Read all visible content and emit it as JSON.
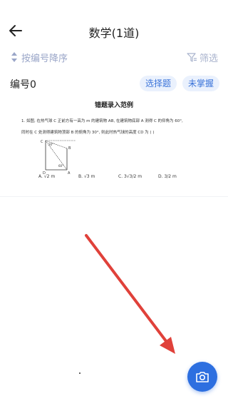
{
  "header": {
    "title": "数学(1道)"
  },
  "toolbar": {
    "sort_label": "按编号降序",
    "filter_label": "筛选"
  },
  "item": {
    "number_label": "编号0",
    "type_tag": "选择题",
    "status_tag": "未掌握"
  },
  "question": {
    "title": "错题录入范例",
    "line1": "1. 如图, 在热气球 C 正前方有一高为 m 的建筑物 AB, 在建筑物底部 A 测得 C 的仰角为 60°,",
    "line2": "同时在 C 处测得建筑物顶部 B 的俯角为 30°, 则此时热气球的高度 CD 为 (      )",
    "diagram_labels": [
      "C",
      "30°",
      "B",
      "60°",
      "D",
      "A"
    ],
    "options": [
      {
        "letter": "A.",
        "value": "√2 m"
      },
      {
        "letter": "B.",
        "value": "√3 m"
      },
      {
        "letter": "C.",
        "value": "3√3/2 m"
      },
      {
        "letter": "D.",
        "value": "3/2 m"
      }
    ]
  },
  "icons": {
    "back": "back-arrow-icon",
    "sort": "sort-icon",
    "filter": "filter-icon",
    "camera": "camera-icon"
  },
  "colors": {
    "accent": "#2d6fe0",
    "tag_bg": "#eaf1fd",
    "annotation_arrow": "#e0413a"
  }
}
